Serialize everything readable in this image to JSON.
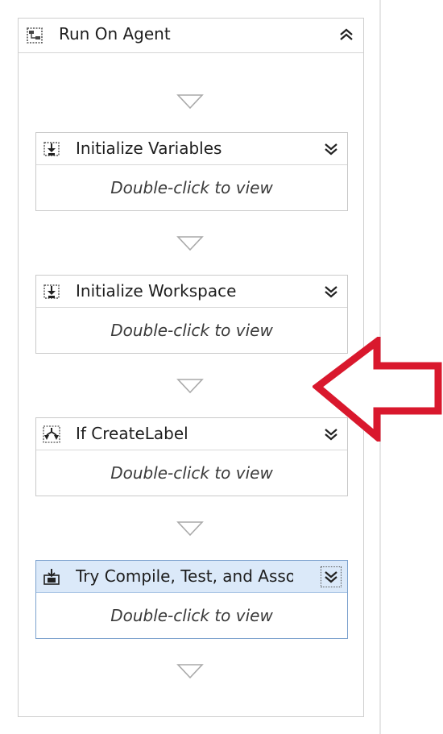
{
  "sequence": {
    "title": "Run On Agent",
    "collapse_label": "Collapse"
  },
  "activities": [
    {
      "title": "Initialize Variables",
      "body": "Double-click to view",
      "icon": "assign-activity-icon",
      "selected": false
    },
    {
      "title": "Initialize Workspace",
      "body": "Double-click to view",
      "icon": "assign-activity-icon",
      "selected": false
    },
    {
      "title": "If CreateLabel",
      "body": "Double-click to view",
      "icon": "if-branch-icon",
      "selected": false
    },
    {
      "title": "Try Compile, Test, and Associate",
      "body": "Double-click to view",
      "icon": "try-catch-icon",
      "selected": true
    }
  ],
  "annotation": {
    "type": "left-pointing-arrow",
    "color": "#d9182d"
  }
}
